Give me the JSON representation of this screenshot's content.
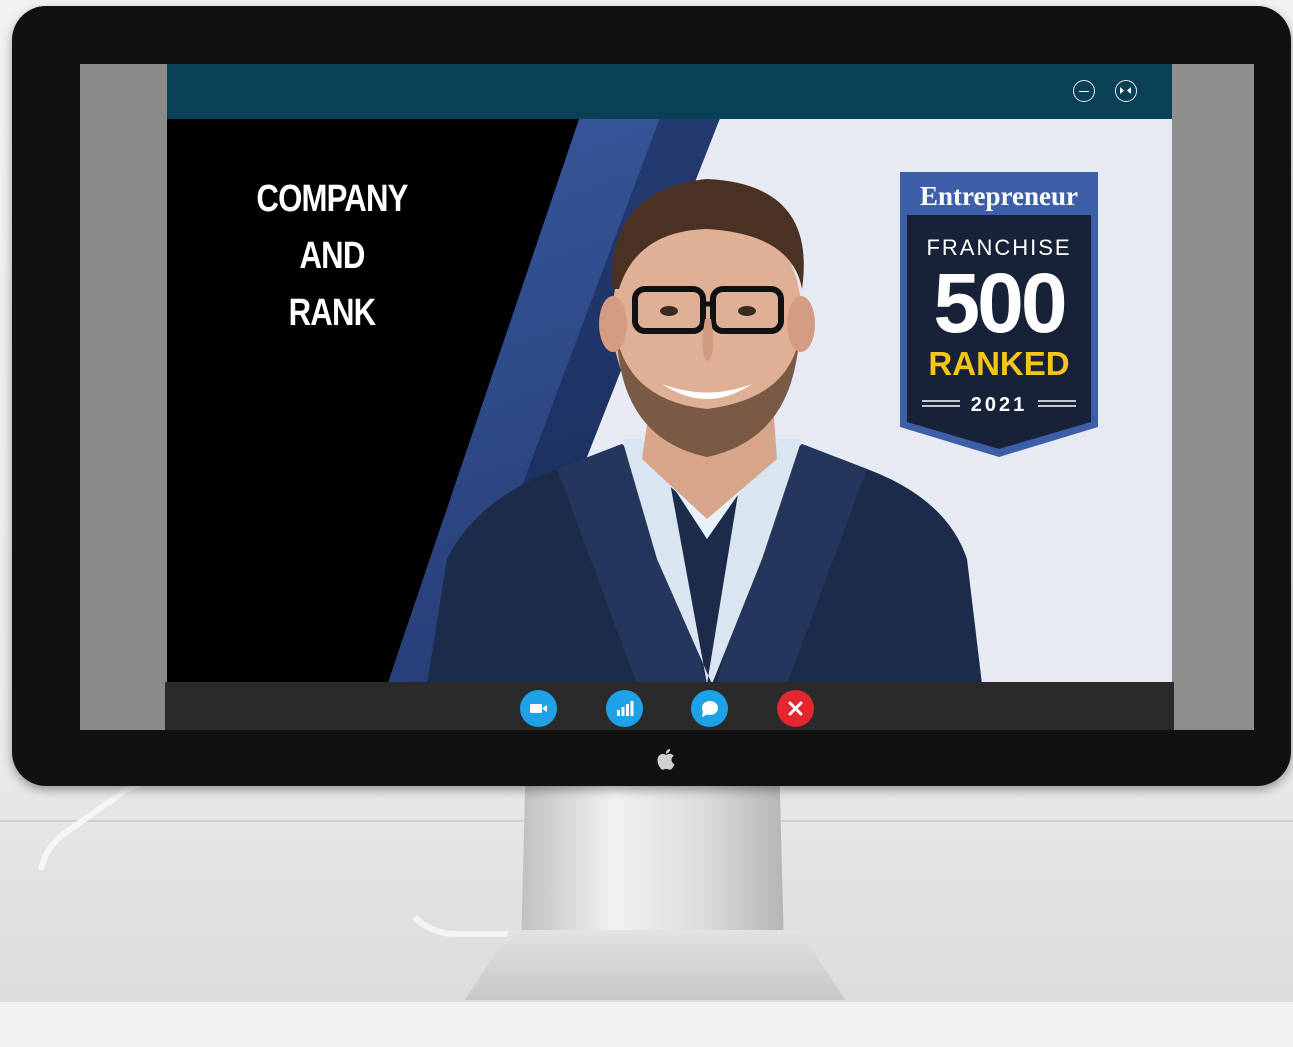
{
  "slide": {
    "heading_lines": [
      "COMPANY",
      "AND",
      "RANK"
    ]
  },
  "badge": {
    "brand": "Entrepreneur",
    "line1": "FRANCHISE",
    "number": "500",
    "rank_word": "RANKED",
    "year": "2021"
  },
  "window_controls": {
    "minimize_icon": "minimize-icon",
    "fullscreen_icon": "exit-fullscreen-icon"
  },
  "call_controls": [
    {
      "name": "video-camera-icon",
      "color": "#1ea1e6"
    },
    {
      "name": "signal-bars-icon",
      "color": "#1ea1e6"
    },
    {
      "name": "chat-bubble-icon",
      "color": "#1ea1e6"
    },
    {
      "name": "close-icon",
      "color": "#e3262f"
    }
  ],
  "colors": {
    "titlebar": "#0a4055",
    "controlbar": "#2a2a2a",
    "badge_navy": "#172239",
    "badge_blue": "#3d5fa8",
    "badge_yellow": "#f5c518"
  }
}
